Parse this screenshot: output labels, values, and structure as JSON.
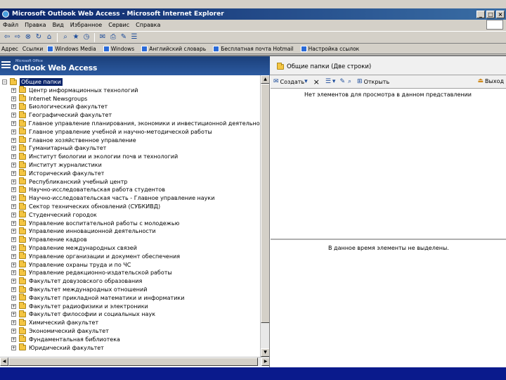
{
  "window": {
    "title": "Microsoft Outlook Web Access - Microsoft Internet Explorer",
    "controls": [
      "_",
      "□",
      "×"
    ]
  },
  "menu": [
    "Файл",
    "Правка",
    "Вид",
    "Избранное",
    "Сервис",
    "Справка"
  ],
  "linksbar": {
    "address_label": "Адрес",
    "links_label": "Ссылки",
    "links": [
      "Windows Media",
      "Windows",
      "Английский словарь",
      "Бесплатная почта Hotmail",
      "Настройка ссылок"
    ]
  },
  "owa": {
    "logo_small": "Microsoft Office",
    "logo": "Outlook Web Access",
    "folder_title": "Общие папки (Две строки)"
  },
  "tree": {
    "root": "Общие папки",
    "items": [
      "Центр информационных технологий",
      "Internet Newsgroups",
      "Биологический факультет",
      "Географический факультет",
      "Главное управление планирования, экономики и инвестиционной деятельности",
      "Главное управление учебной и научно-методической работы",
      "Главное хозяйственное управление",
      "Гуманитарный факультет",
      "Институт биологии и экологии почв и технологий",
      "Институт журналистики",
      "Исторический факультет",
      "Республиканский учебный центр",
      "Научно-исследовательская работа студентов",
      "Научно-исследовательская часть - Главное управление науки",
      "Сектор технических обновлений (СУБКИВД)",
      "Студенческий городок",
      "Управление воспитательной работы с молодежью",
      "Управление инновационной деятельности",
      "Управление кадров",
      "Управление международных связей",
      "Управление организации и документ обеспечения",
      "Управление охраны труда и по ЧС",
      "Управление редакционно-издательской работы",
      "Факультет довузовского образования",
      "Факультет международных отношений",
      "Факультет прикладной математики и информатики",
      "Факультет радиофизики и электроники",
      "Факультет философии и социальных наук",
      "Химический факультет",
      "Экономический факультет",
      "Фундаментальная библиотека",
      "Юридический факультет"
    ]
  },
  "right_toolbar": {
    "create": "Создать",
    "delete": "×",
    "view": "Открыть",
    "exit": "Выход"
  },
  "list": {
    "empty_text": "Нет элементов для просмотра в данном представлении"
  },
  "preview": {
    "text": "В данное время элементы не выделены."
  }
}
